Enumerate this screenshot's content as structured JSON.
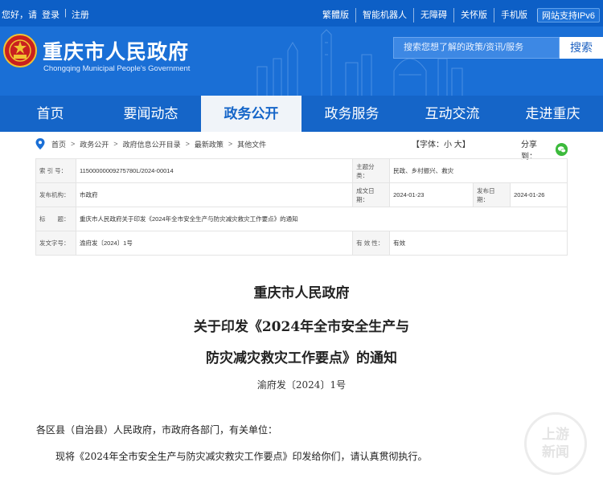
{
  "topbar": {
    "greeting": "您好，请",
    "login": "登录",
    "register": "注册",
    "links": [
      "繁體版",
      "智能机器人",
      "无障碍",
      "关怀版",
      "手机版"
    ],
    "ipv6": "网站支持IPv6"
  },
  "header": {
    "title": "重庆市人民政府",
    "subtitle": "Chongqing Municipal People's Government",
    "search_placeholder": "搜索您想了解的政策/资讯/服务",
    "search_button": "搜索"
  },
  "nav": [
    "首页",
    "要闻动态",
    "政务公开",
    "政务服务",
    "互动交流",
    "走进重庆"
  ],
  "breadcrumb": {
    "items": [
      "首页",
      "政务公开",
      "政府信息公开目录",
      "最新政策",
      "其他文件"
    ],
    "font_label": "【字体：",
    "font_small": "小",
    "font_large": "大",
    "font_close": "】",
    "share_label": "分享到："
  },
  "info": {
    "index_label": "索 引 号：",
    "index_value": "11500000009275780L/2024-00014",
    "topic_label": "主题分类：",
    "topic_value": "民政、乡村振兴、救灾",
    "org_label": "发布机构：",
    "org_value": "市政府",
    "made_label": "成文日期：",
    "made_value": "2024-01-23",
    "pub_label": "发布日期：",
    "pub_value": "2024-01-26",
    "title_label": "标　　题：",
    "title_value": "重庆市人民政府关于印发《2024年全市安全生产与防灾减灾救灾工作要点》的通知",
    "docno_label": "发文字号：",
    "docno_value": "渝府发〔2024〕1号",
    "valid_label": "有 效 性：",
    "valid_value": "有效"
  },
  "document": {
    "issuer": "重庆市人民政府",
    "title_line1": "关于印发《2024年全市安全生产与",
    "title_line2": "防灾减灾救灾工作要点》的通知",
    "doc_number": "渝府发〔2024〕1号",
    "salutation": "各区县（自治县）人民政府，市政府各部门，有关单位：",
    "body": "现将《2024年全市安全生产与防灾减灾救灾工作要点》印发给你们，请认真贯彻执行。"
  },
  "watermark": {
    "line1": "上游",
    "line2": "新闻"
  },
  "colors": {
    "primary": "#1565c8",
    "topbar": "#0d5fc6",
    "wechat": "#3cba3c"
  }
}
